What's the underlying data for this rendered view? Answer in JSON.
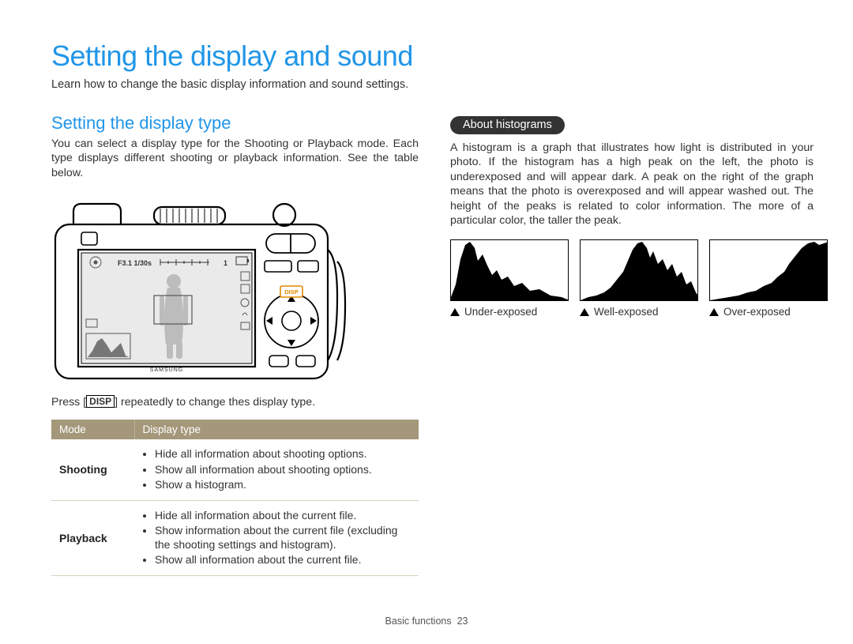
{
  "title": "Setting the display and sound",
  "intro": "Learn how to change the basic display information and sound settings.",
  "left": {
    "heading": "Setting the display type",
    "para": "You can select a display type for the Shooting or Playback mode. Each type displays different shooting or playback information. See the table below.",
    "camera": {
      "screen_top": "F3.1  1/30s",
      "mode_indicator": "1",
      "disp_button": "DISP",
      "brand": "SAMSUNG"
    },
    "press_prefix": "Press [",
    "disp_label": "DISP",
    "press_suffix": "] repeatedly to change thes display type.",
    "table": {
      "headers": [
        "Mode",
        "Display type"
      ],
      "rows": [
        {
          "mode": "Shooting",
          "items": [
            "Hide all information about shooting options.",
            "Show all information about shooting options.",
            "Show a histogram."
          ]
        },
        {
          "mode": "Playback",
          "items": [
            "Hide all information about the current file.",
            "Show information about the current file (excluding the shooting settings and histogram).",
            "Show all information about the current file."
          ]
        }
      ]
    }
  },
  "right": {
    "pill": "About histograms",
    "para": "A histogram is a graph that illustrates how light is distributed in your photo. If the histogram has a high peak on the left, the photo is underexposed and will appear dark. A peak on the right of the graph means that the photo is overexposed and will appear washed out. The height of the peaks is related to color information. The more of a particular color, the taller the peak.",
    "histograms": [
      {
        "caption": "Under-exposed"
      },
      {
        "caption": "Well-exposed"
      },
      {
        "caption": "Over-exposed"
      }
    ]
  },
  "footer": {
    "section": "Basic functions",
    "page": "23"
  }
}
